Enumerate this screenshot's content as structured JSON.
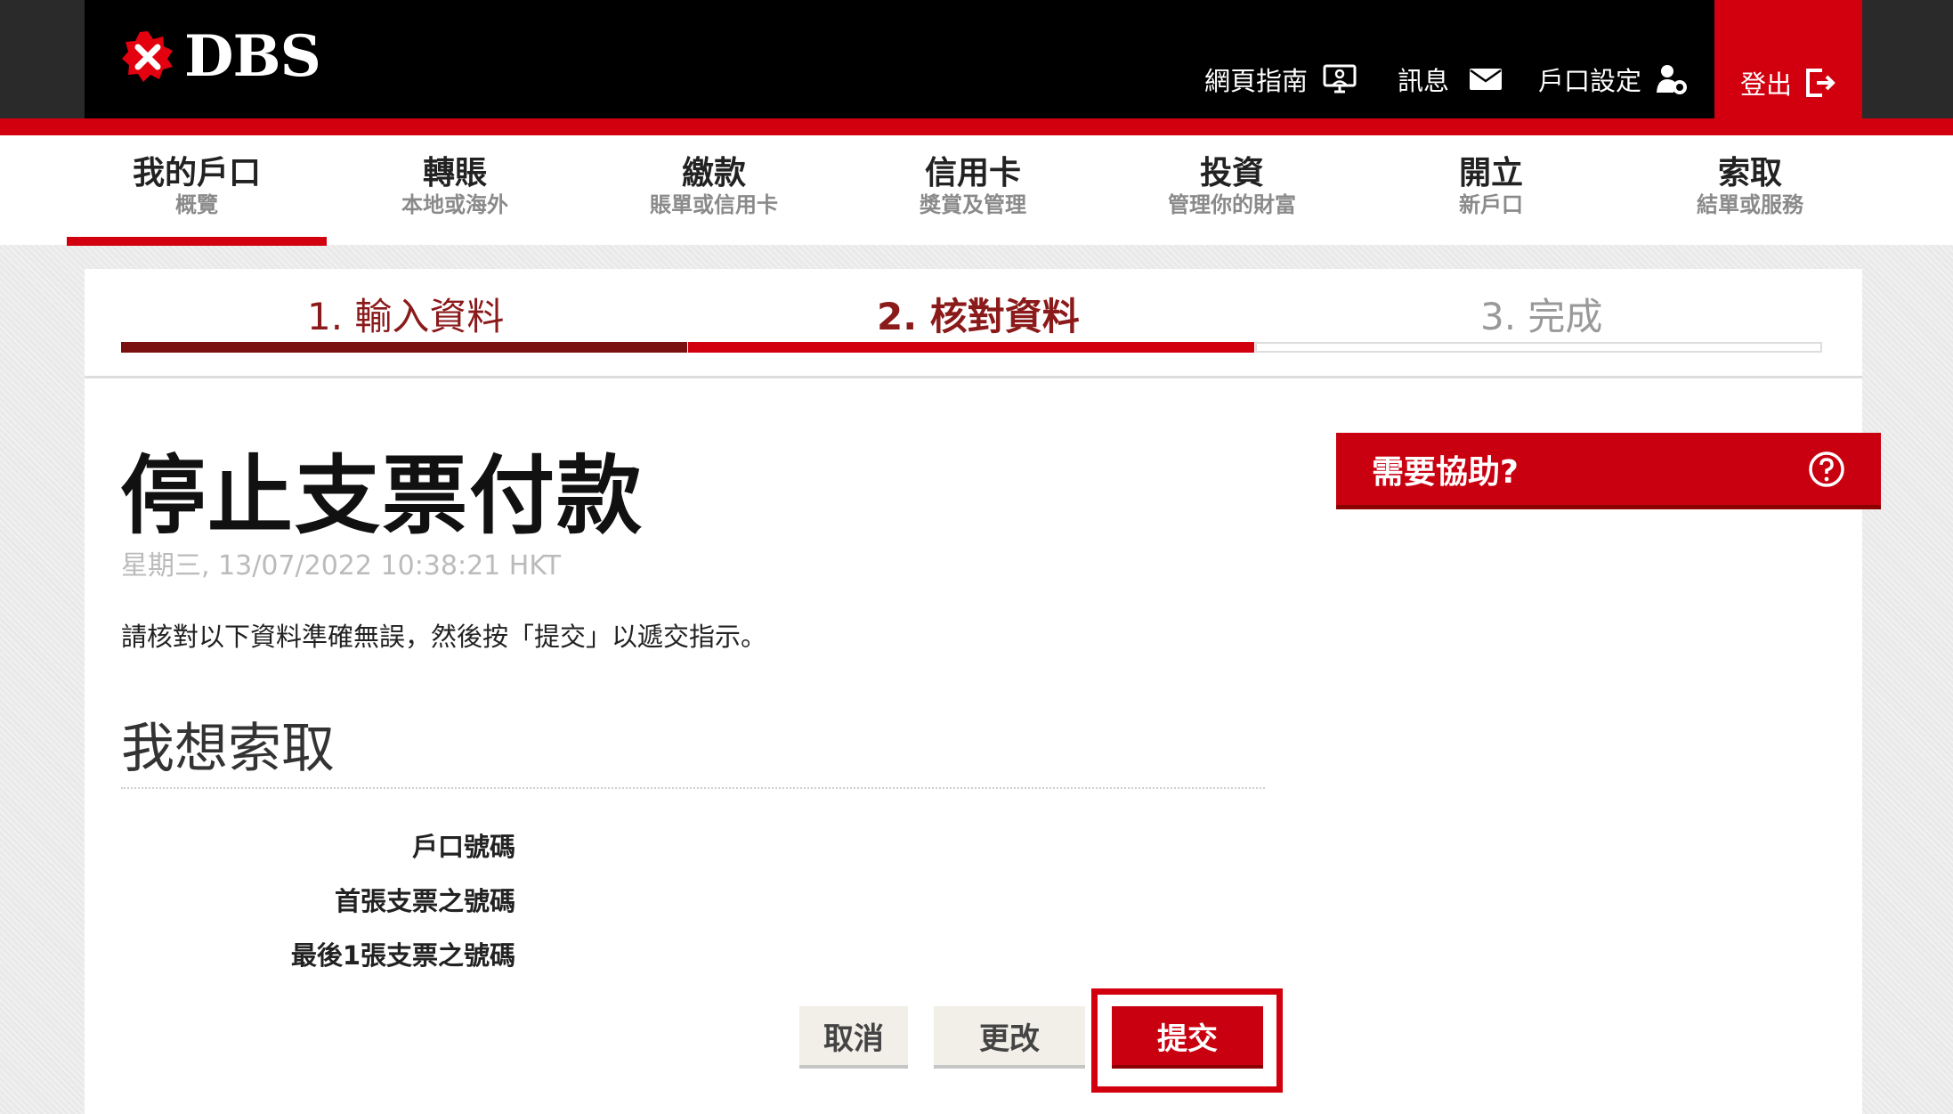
{
  "brand": {
    "name": "DBS",
    "colors": {
      "red": "#d2000f",
      "dark_red": "#8b1a1a",
      "black": "#000000"
    }
  },
  "header": {
    "utilities": [
      {
        "label": "網頁指南",
        "icon": "monitor-user-icon"
      },
      {
        "label": "訊息",
        "icon": "envelope-icon"
      },
      {
        "label": "戶口設定",
        "icon": "user-gear-icon"
      }
    ],
    "logout": {
      "label": "登出",
      "icon": "logout-icon"
    }
  },
  "nav": {
    "items": [
      {
        "title": "我的戶口",
        "sub": "概覽",
        "active": true
      },
      {
        "title": "轉賬",
        "sub": "本地或海外"
      },
      {
        "title": "繳款",
        "sub": "賬單或信用卡"
      },
      {
        "title": "信用卡",
        "sub": "獎賞及管理"
      },
      {
        "title": "投資",
        "sub": "管理你的財富"
      },
      {
        "title": "開立",
        "sub": "新戶口"
      },
      {
        "title": "索取",
        "sub": "結單或服務"
      }
    ]
  },
  "steps": {
    "s1": "1. 輸入資料",
    "s2": "2. 核對資料",
    "s3": "3. 完成",
    "current": 2
  },
  "page": {
    "title": "停止支票付款",
    "timestamp": "星期三, 13/07/2022 10:38:21 HKT",
    "instruction": "請核對以下資料準確無誤，然後按「提交」以遞交指示。",
    "section_title": "我想索取"
  },
  "fields": {
    "account_number": {
      "label": "戶口號碼"
    },
    "first_cheque": {
      "label": "首張支票之號碼"
    },
    "last_cheque": {
      "label": "最後1張支票之號碼"
    }
  },
  "help": {
    "label": "需要協助?",
    "icon": "question-circle-icon"
  },
  "buttons": {
    "cancel": "取消",
    "modify": "更改",
    "submit": "提交"
  }
}
